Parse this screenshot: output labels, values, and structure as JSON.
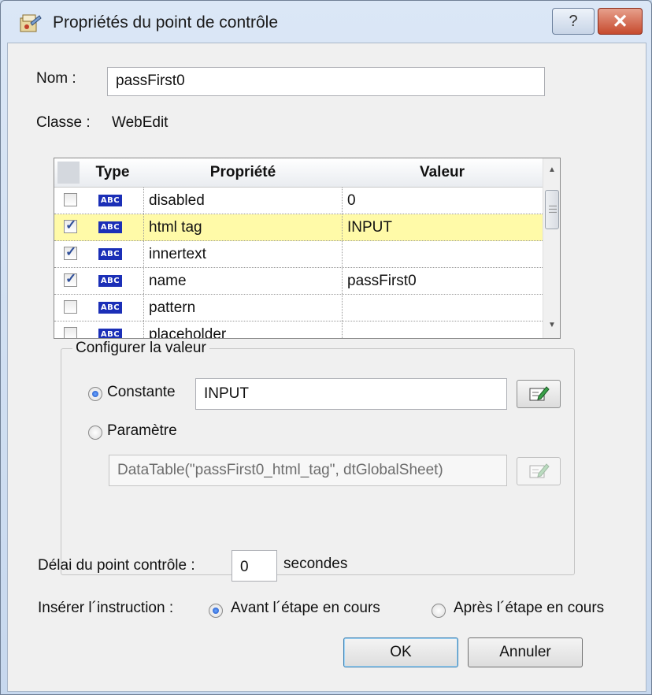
{
  "window": {
    "title": "Propriétés du point de contrôle",
    "help_glyph": "?",
    "close_glyph": "✕"
  },
  "name": {
    "label": "Nom :",
    "value": "passFirst0"
  },
  "class_info": {
    "label": "Classe :",
    "value": "WebEdit"
  },
  "grid": {
    "columns": {
      "type": "Type",
      "property": "Propriété",
      "value": "Valeur"
    },
    "type_badge": "ABC",
    "rows": [
      {
        "checked": false,
        "property": "disabled",
        "value": "0",
        "selected": false
      },
      {
        "checked": true,
        "property": "html tag",
        "value": "INPUT",
        "selected": true
      },
      {
        "checked": true,
        "property": "innertext",
        "value": "",
        "selected": false
      },
      {
        "checked": true,
        "property": "name",
        "value": "passFirst0",
        "selected": false
      },
      {
        "checked": false,
        "property": "pattern",
        "value": "",
        "selected": false
      },
      {
        "checked": false,
        "property": "placeholder",
        "value": "",
        "selected": false
      }
    ]
  },
  "configure": {
    "legend": "Configurer la valeur",
    "constant_label": "Constante",
    "constant_value": "INPUT",
    "constant_selected": true,
    "parameter_label": "Paramètre",
    "parameter_value": "DataTable(\"passFirst0_html_tag\", dtGlobalSheet)",
    "parameter_selected": false
  },
  "timeout": {
    "label": "Délai du point contrôle :",
    "value": "0",
    "unit": "secondes"
  },
  "insert": {
    "label": "Insérer l´instruction :",
    "before_label": "Avant l´étape en cours",
    "after_label": "Après l´étape en cours",
    "before_selected": true
  },
  "buttons": {
    "ok": "OK",
    "cancel": "Annuler"
  }
}
